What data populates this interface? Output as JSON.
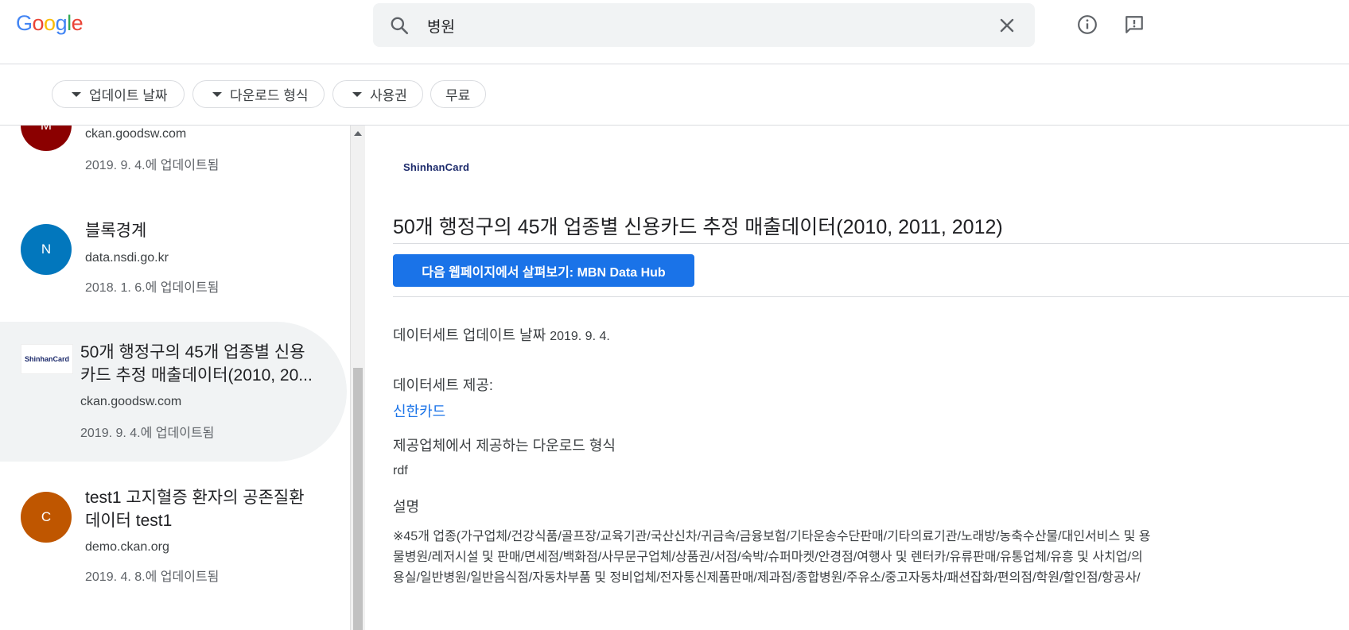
{
  "header": {
    "logo": [
      "G",
      "o",
      "o",
      "g",
      "l",
      "e"
    ],
    "logo_colors": [
      "#4285f4",
      "#ea4335",
      "#fbbc05",
      "#4285f4",
      "#34a853",
      "#ea4335"
    ],
    "search_value": "병원",
    "icons": [
      "search-icon",
      "close-icon",
      "info-icon",
      "feedback-icon"
    ]
  },
  "filters": {
    "chips": [
      "업데이트 날짜",
      "다운로드 형식",
      "사용권",
      "무료"
    ]
  },
  "results": [
    {
      "avatar_letter": "M",
      "avatar_color": "#8b0000",
      "title": "",
      "domain": "ckan.goodsw.com",
      "date": "2019. 9. 4.에 업데이트됨"
    },
    {
      "avatar_letter": "N",
      "avatar_color": "#0277bd",
      "title": "블록경계",
      "domain": "data.nsdi.go.kr",
      "date": "2018. 1. 6.에 업데이트됨"
    },
    {
      "thumb_text": "ShinhanCard",
      "title_line1": "50개 행정구의 45개 업종별 신용",
      "title_line2": "카드 추정 매출데이터(2010, 20...",
      "domain": "ckan.goodsw.com",
      "date": "2019. 9. 4.에 업데이트됨"
    },
    {
      "avatar_letter": "C",
      "avatar_color": "#bf5600",
      "title_line1": "test1 고지혈증 환자의 공존질환",
      "title_line2": "데이터 test1",
      "domain": "demo.ckan.org",
      "date": "2019. 4. 8.에 업데이트됨"
    }
  ],
  "detail": {
    "logo_text": "ShinhanCard",
    "title": "50개 행정구의 45개 업종별 신용카드 추정 매출데이터(2010, 2011, 2012)",
    "button_label": "다음 웹페이지에서 살펴보기: MBN Data Hub",
    "updated_label": "데이터세트 업데이트 날짜",
    "updated_value": "2019. 9. 4.",
    "provider_label": "데이터세트 제공:",
    "provider_value": "신한카드",
    "formats_label": "제공업체에서 제공하는 다운로드 형식",
    "formats_value": "rdf",
    "desc_label": "설명",
    "desc_lines": [
      "※45개 업종(가구업체/건강식품/골프장/교육기관/국산신차/귀금속/금융보험/기타운송수단판매/기타의료기관/노래방/농축수산물/대인서비스 및 용",
      "물병원/레저시설 및 판매/면세점/백화점/사무문구업체/상품권/서점/숙박/슈퍼마켓/안경점/여행사 및 렌터카/유류판매/유통업체/유흥 및 사치업/의",
      "용실/일반병원/일반음식점/자동차부품 및 정비업체/전자통신제품판매/제과점/종합병원/주유소/중고자동차/패션잡화/편의점/학원/할인점/항공사/"
    ]
  }
}
